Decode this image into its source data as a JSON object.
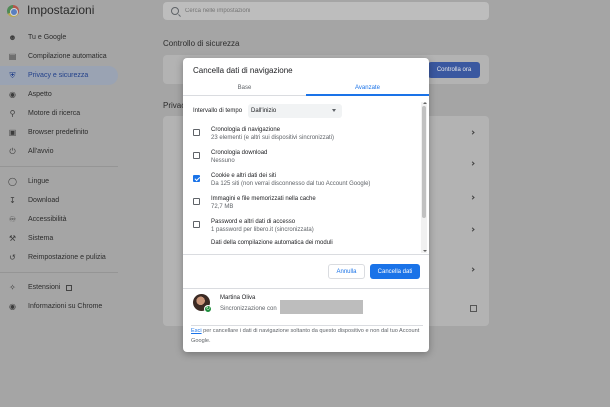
{
  "app": {
    "title": "Impostazioni",
    "search_placeholder": "Cerca nelle impostazioni"
  },
  "sidebar": {
    "items": [
      {
        "label": "Tu e Google",
        "icon": "person-icon",
        "active": false
      },
      {
        "label": "Compilazione automatica",
        "icon": "clipboard-icon",
        "active": false
      },
      {
        "label": "Privacy e sicurezza",
        "icon": "shield-icon",
        "active": true
      },
      {
        "label": "Aspetto",
        "icon": "palette-icon",
        "active": false
      },
      {
        "label": "Motore di ricerca",
        "icon": "search-icon",
        "active": false
      },
      {
        "label": "Browser predefinito",
        "icon": "browser-icon",
        "active": false
      },
      {
        "label": "All'avvio",
        "icon": "power-icon",
        "active": false
      }
    ],
    "items2": [
      {
        "label": "Lingue",
        "icon": "globe-icon"
      },
      {
        "label": "Download",
        "icon": "download-icon"
      },
      {
        "label": "Accessibilità",
        "icon": "accessibility-icon"
      },
      {
        "label": "Sistema",
        "icon": "wrench-icon"
      },
      {
        "label": "Reimpostazione e pulizia",
        "icon": "reset-icon"
      }
    ],
    "items3": [
      {
        "label": "Estensioni",
        "icon": "puzzle-icon"
      },
      {
        "label": "Informazioni su Chrome",
        "icon": "chrome-icon"
      }
    ]
  },
  "main": {
    "safety_title": "Controllo di sicurezza",
    "safety_button": "Controlla ora",
    "privacy_title": "Privac"
  },
  "dialog": {
    "title": "Cancella dati di navigazione",
    "tabs": [
      {
        "label": "Base",
        "active": false
      },
      {
        "label": "Avanzate",
        "active": true
      }
    ],
    "range_label": "Intervallo di tempo",
    "range_value": "Dall'inizio",
    "items": [
      {
        "title": "Cronologia di navigazione",
        "subtitle": "23 elementi (e altri sui dispositivi sincronizzati)",
        "checked": false
      },
      {
        "title": "Cronologia download",
        "subtitle": "Nessuno",
        "checked": false
      },
      {
        "title": "Cookie e altri dati dei siti",
        "subtitle": "Da 125 siti (non verrai disconnesso dal tuo Account Google)",
        "checked": true
      },
      {
        "title": "Immagini e file memorizzati nella cache",
        "subtitle": "72,7 MB",
        "checked": false
      },
      {
        "title": "Password e altri dati di accesso",
        "subtitle": "1 password per libero.it (sincronizzata)",
        "checked": false
      },
      {
        "title": "Dati della compilazione automatica dei moduli",
        "subtitle": "",
        "checked": false
      }
    ],
    "cancel_label": "Annulla",
    "clear_label": "Cancella dati",
    "account": {
      "name": "Martina Oliva",
      "sync_text": "Sincronizzazione con"
    },
    "note": {
      "link": "Esci",
      "text": " per cancellare i dati di navigazione soltanto da questo dispositivo e non dal tuo Account Google."
    }
  },
  "colors": {
    "accent": "#1a73e8",
    "overlay": "#a5a5a5",
    "sync_green": "#1e8e3e"
  }
}
